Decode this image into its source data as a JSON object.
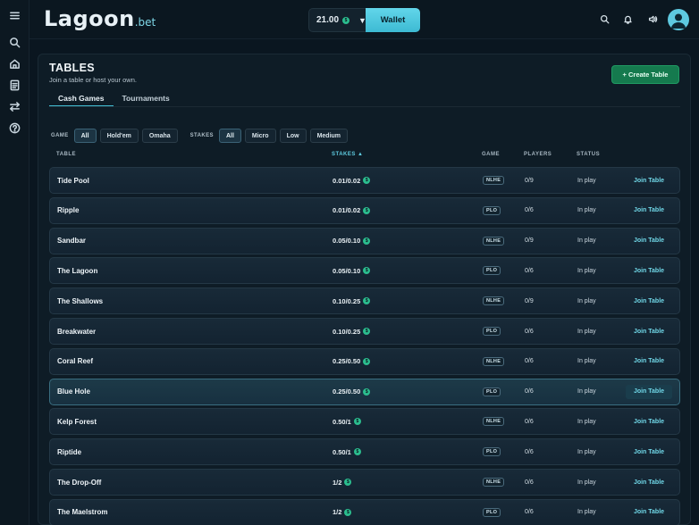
{
  "brand": {
    "logo": "Lagoon",
    "logo_suffix": ".bet"
  },
  "header": {
    "balance": "21.00",
    "wallet_label": "Wallet"
  },
  "sidebar": {
    "icons": [
      "menu-icon",
      "search-icon",
      "home-icon",
      "document-icon",
      "swap-icon",
      "help-icon"
    ]
  },
  "page": {
    "title": "TABLES",
    "subtitle": "Join a table or host your own.",
    "create_label": "+ Create Table",
    "tabs": [
      {
        "label": "Cash Games",
        "active": true
      },
      {
        "label": "Tournaments",
        "active": false
      }
    ]
  },
  "filters": {
    "game_label": "GAME",
    "game_options": [
      "All",
      "Hold'em",
      "Omaha"
    ],
    "game_active": "All",
    "stakes_label": "STAKES",
    "stakes_options": [
      "All",
      "Micro",
      "Low",
      "Medium"
    ],
    "stakes_active": "All"
  },
  "table_headers": {
    "table": "TABLE",
    "stakes": "STAKES ▲",
    "game": "GAME",
    "players": "PLAYERS",
    "status": "STATUS"
  },
  "join_label": "Join Table",
  "rows": [
    {
      "name": "Tide Pool",
      "stakes": "0.01/0.02",
      "game": "NLHE",
      "players": "0/9",
      "status": "In play"
    },
    {
      "name": "Ripple",
      "stakes": "0.01/0.02",
      "game": "PLO",
      "players": "0/6",
      "status": "In play"
    },
    {
      "name": "Sandbar",
      "stakes": "0.05/0.10",
      "game": "NLHE",
      "players": "0/9",
      "status": "In play"
    },
    {
      "name": "The Lagoon",
      "stakes": "0.05/0.10",
      "game": "PLO",
      "players": "0/6",
      "status": "In play"
    },
    {
      "name": "The Shallows",
      "stakes": "0.10/0.25",
      "game": "NLHE",
      "players": "0/9",
      "status": "In play"
    },
    {
      "name": "Breakwater",
      "stakes": "0.10/0.25",
      "game": "PLO",
      "players": "0/6",
      "status": "In play"
    },
    {
      "name": "Coral Reef",
      "stakes": "0.25/0.50",
      "game": "NLHE",
      "players": "0/6",
      "status": "In play"
    },
    {
      "name": "Blue Hole",
      "stakes": "0.25/0.50",
      "game": "PLO",
      "players": "0/6",
      "status": "In play",
      "highlighted": true
    },
    {
      "name": "Kelp Forest",
      "stakes": "0.50/1",
      "game": "NLHE",
      "players": "0/6",
      "status": "In play"
    },
    {
      "name": "Riptide",
      "stakes": "0.50/1",
      "game": "PLO",
      "players": "0/6",
      "status": "In play"
    },
    {
      "name": "The Drop-Off",
      "stakes": "1/2",
      "game": "NLHE",
      "players": "0/6",
      "status": "In play"
    },
    {
      "name": "The Maelstrom",
      "stakes": "1/2",
      "game": "PLO",
      "players": "0/6",
      "status": "In play"
    }
  ],
  "colors": {
    "accent": "#44c2d8",
    "create_green": "#157a4e",
    "coin": "#2bbd8e",
    "background": "#0a1620"
  }
}
